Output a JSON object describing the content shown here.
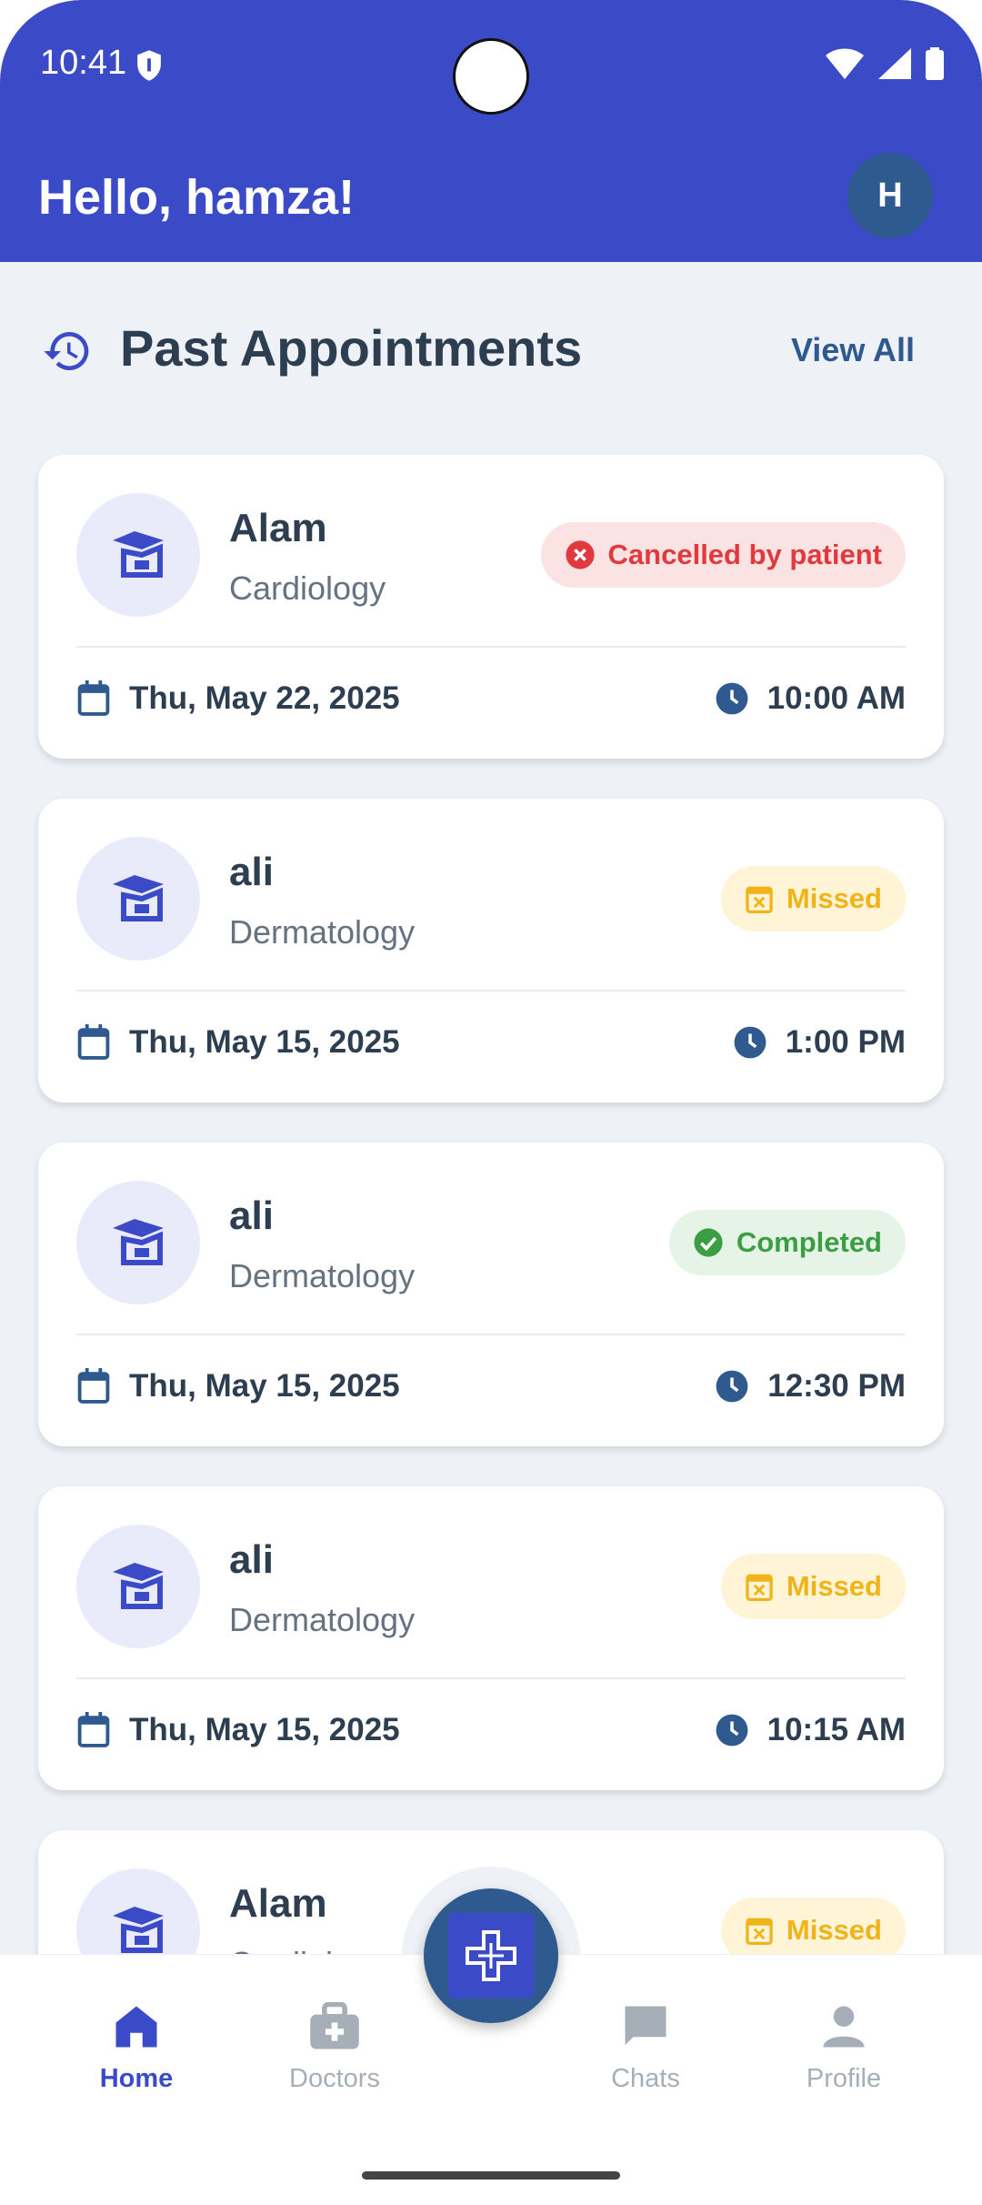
{
  "status_bar": {
    "time": "10:41",
    "shield_icon": "shield-icon",
    "wifi_icon": "wifi-icon",
    "signal_icon": "signal-icon",
    "battery_icon": "battery-icon"
  },
  "header": {
    "greeting": "Hello, hamza!",
    "avatar_initial": "H",
    "background": "#3b4bc8"
  },
  "section": {
    "title": "Past Appointments",
    "view_all": "View All",
    "icon": "history-icon"
  },
  "appointments": [
    {
      "doctor": "Alam",
      "specialty": "Cardiology",
      "status": "Cancelled by patient",
      "status_type": "cancelled",
      "date": "Thu, May 22, 2025",
      "time": "10:00 AM"
    },
    {
      "doctor": "ali",
      "specialty": "Dermatology",
      "status": "Missed",
      "status_type": "missed",
      "date": "Thu, May 15, 2025",
      "time": "1:00 PM"
    },
    {
      "doctor": "ali",
      "specialty": "Dermatology",
      "status": "Completed",
      "status_type": "completed",
      "date": "Thu, May 15, 2025",
      "time": "12:30 PM"
    },
    {
      "doctor": "ali",
      "specialty": "Dermatology",
      "status": "Missed",
      "status_type": "missed",
      "date": "Thu, May 15, 2025",
      "time": "10:15 AM"
    },
    {
      "doctor": "Alam",
      "specialty": "Cardiology",
      "status": "Missed",
      "status_type": "missed",
      "date": "",
      "time": ""
    }
  ],
  "nav": {
    "home": "Home",
    "doctors": "Doctors",
    "chats": "Chats",
    "profile": "Profile",
    "active": "home"
  },
  "colors": {
    "primary": "#3b4bc8",
    "accent_dark": "#2f5a8f",
    "cancelled": "#e03a3e",
    "missed": "#f0b41a",
    "completed": "#3c9e44"
  }
}
